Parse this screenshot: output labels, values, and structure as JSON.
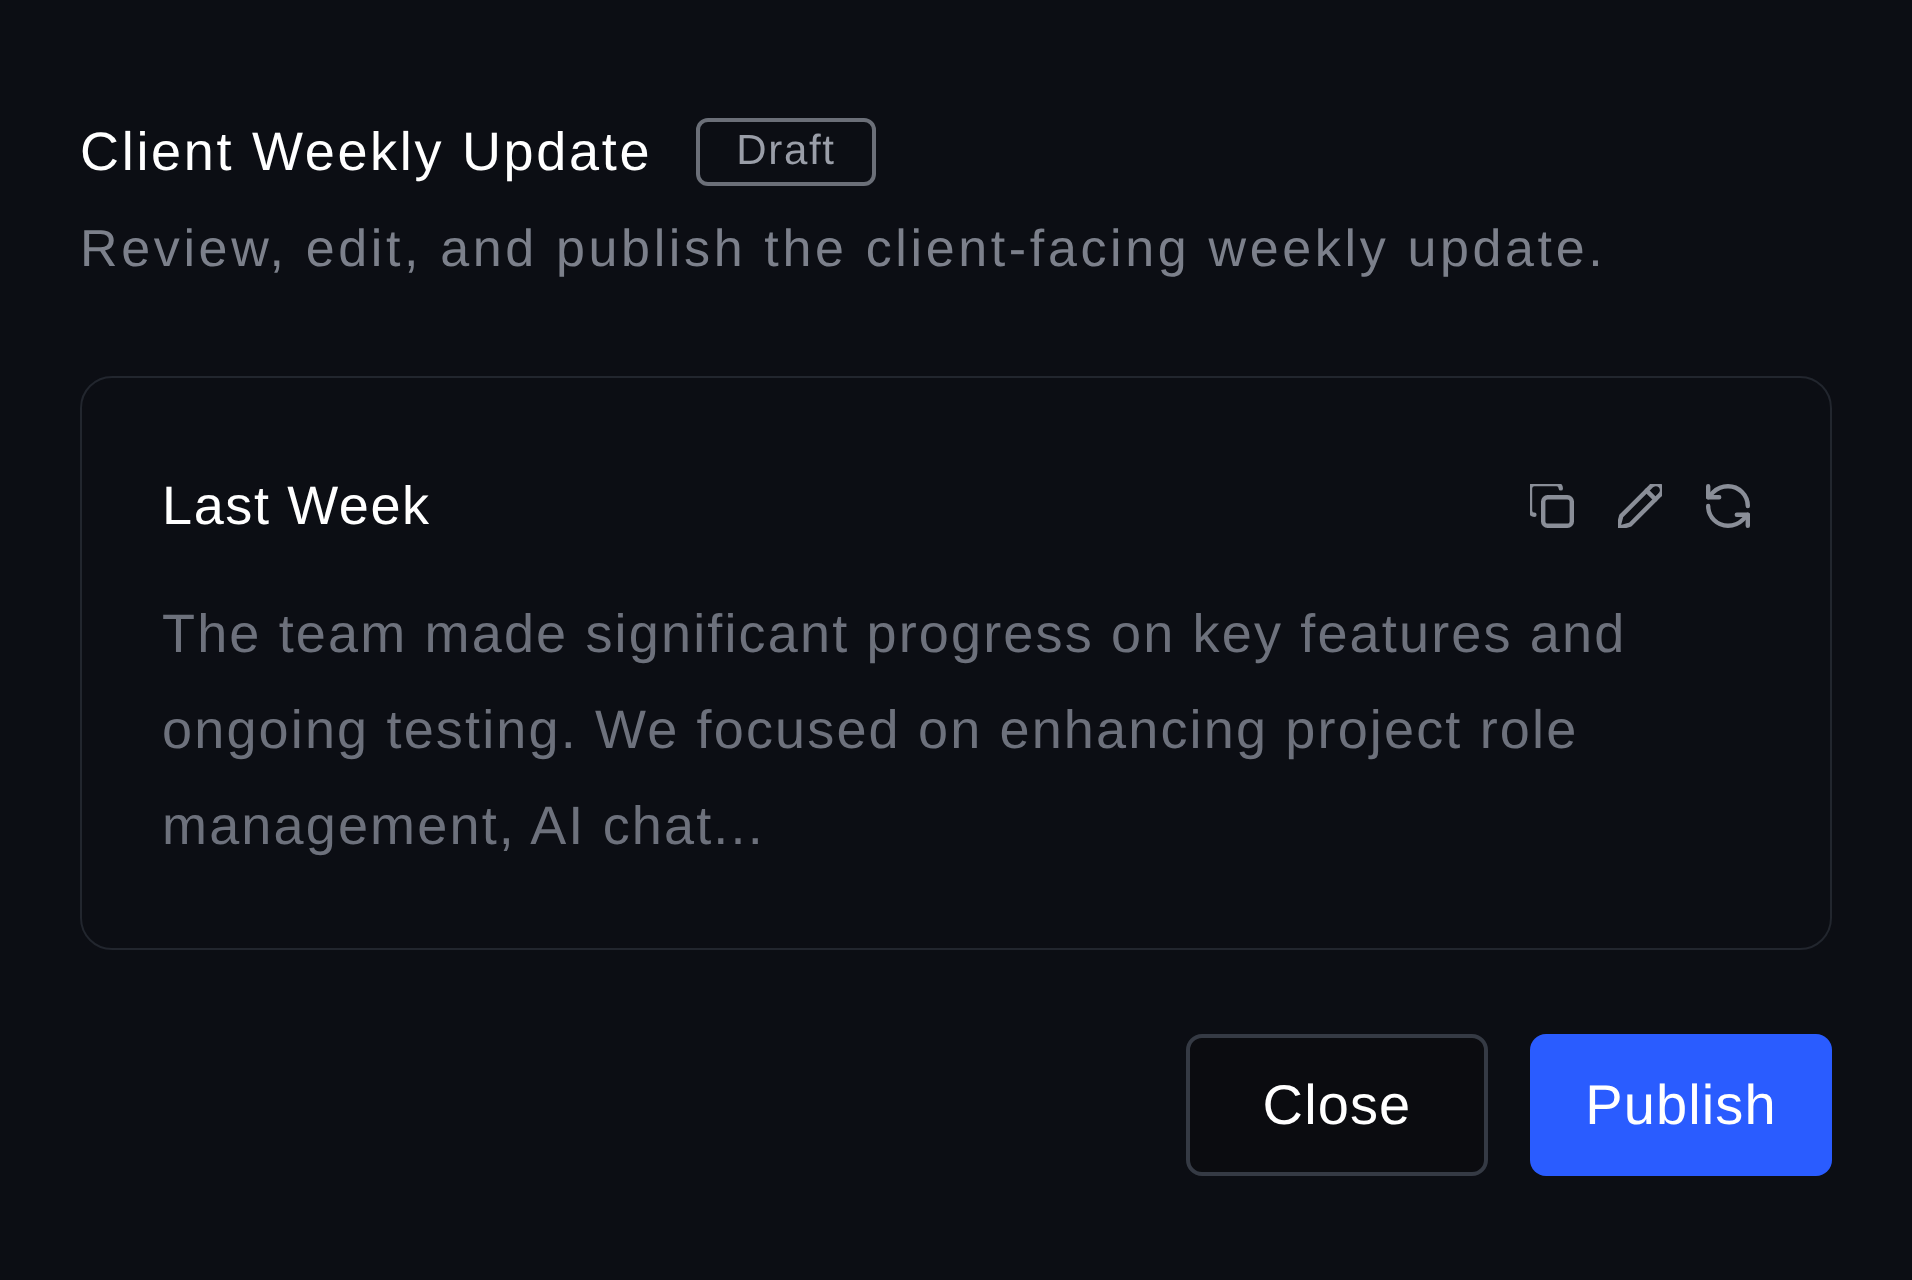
{
  "dialog": {
    "title": "Client Weekly Update",
    "badge": "Draft",
    "description": "Review, edit, and publish the client-facing weekly update."
  },
  "section": {
    "title": "Last Week",
    "body": "The team made significant progress on key features and ongoing testing. We focused on enhancing project role management, AI chat..."
  },
  "buttons": [
    {
      "label": "Close",
      "kind": "secondary"
    },
    {
      "label": "Publish",
      "kind": "primary"
    }
  ]
}
